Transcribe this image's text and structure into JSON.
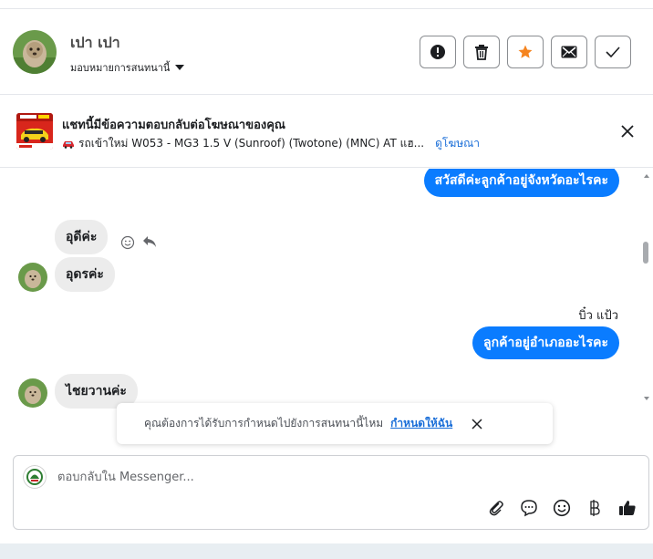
{
  "header": {
    "contact_name": "เปา เปา",
    "assign_label": "มอบหมายการสนทนานี้"
  },
  "ad": {
    "title": "แชทนี้มีข้อความตอบกลับต่อโฆษณาของคุณ",
    "description": "รถเข้าใหม่ W053 - MG3 1.5 V (Sunroof) (Twotone) (MNC) AT แฮ...",
    "link_label": "ดูโฆษณา"
  },
  "messages": [
    {
      "direction": "outgoing",
      "text": "สวัสดีค่ะลูกค้าอยู่จังหวัดอะไรคะ"
    },
    {
      "direction": "incoming",
      "text": "อุดีค่ะ"
    },
    {
      "direction": "incoming",
      "text": "อุดรค่ะ"
    },
    {
      "direction": "outgoing",
      "sender": "บิ๋ว แป้ว",
      "text": "ลูกค้าอยู่อำเภออะไรคะ"
    },
    {
      "direction": "incoming",
      "text": "ไชยวานค่ะ"
    }
  ],
  "suggestion": {
    "text": "คุณต้องการได้รับการกำหนดไปยังการสนทนานี้ไหม",
    "link_label": "กำหนดให้ฉัน"
  },
  "composer": {
    "placeholder": "ตอบกลับใน Messenger..."
  },
  "icons": {
    "header_actions": [
      "alert-icon",
      "trash-icon",
      "star-icon",
      "envelope-icon",
      "check-icon"
    ],
    "composer_tools": [
      "paperclip-icon",
      "chat-bubble-icon",
      "emoji-icon",
      "baht-icon",
      "thumbs-up-icon"
    ]
  },
  "colors": {
    "accent": "#0a7cff",
    "link": "#1a6ed8",
    "star": "#f5841f",
    "incoming_bubble": "#ececec"
  }
}
